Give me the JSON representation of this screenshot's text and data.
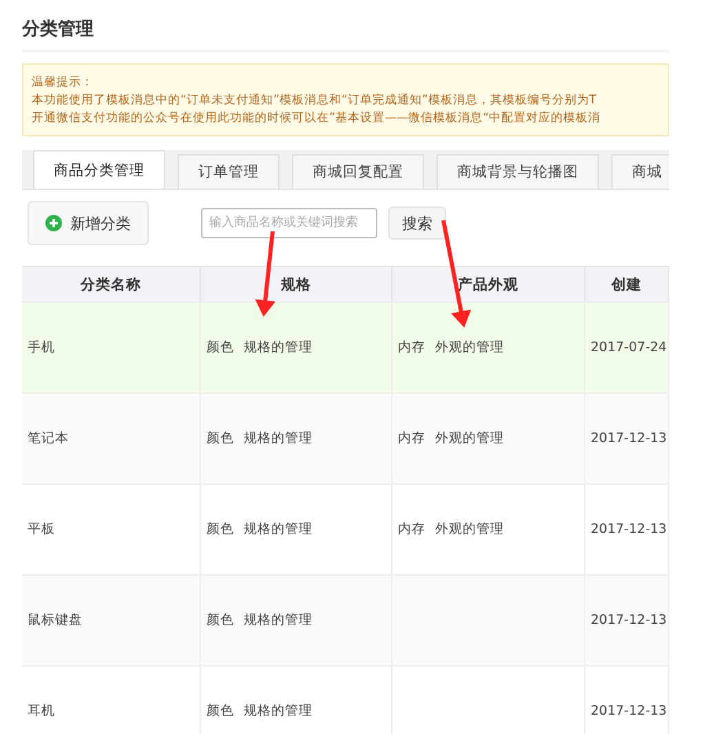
{
  "page_title": "分类管理",
  "notice": {
    "heading": "温馨提示：",
    "lines": [
      "本功能使用了模板消息中的“订单未支付通知”模板消息和“订单完成通知”模板消息，其模板编号分别为T",
      "开通微信支付功能的公众号在使用此功能的时候可以在”基本设置——微信模板消息“中配置对应的模板消"
    ]
  },
  "tabs": [
    {
      "label": "商品分类管理",
      "selected": true
    },
    {
      "label": "订单管理",
      "selected": false
    },
    {
      "label": "商城回复配置",
      "selected": false
    },
    {
      "label": "商城背景与轮播图",
      "selected": false
    },
    {
      "label": "商城",
      "selected": false
    }
  ],
  "toolbar": {
    "add_button": "新增分类",
    "search": {
      "placeholder": "输入商品名称或关键词搜索"
    },
    "search_button": "搜索"
  },
  "table": {
    "columns": [
      "分类名称",
      "规格",
      "产品外观",
      "创建"
    ],
    "rows": [
      {
        "name": "手机",
        "spec": [
          "颜色",
          "规格的管理"
        ],
        "appearance": [
          "内存",
          "外观的管理"
        ],
        "created": "2017-07-24",
        "selected": true
      },
      {
        "name": "笔记本",
        "spec": [
          "颜色",
          "规格的管理"
        ],
        "appearance": [
          "内存",
          "外观的管理"
        ],
        "created": "2017-12-13",
        "selected": false
      },
      {
        "name": "平板",
        "spec": [
          "颜色",
          "规格的管理"
        ],
        "appearance": [
          "内存",
          "外观的管理"
        ],
        "created": "2017-12-13",
        "selected": false
      },
      {
        "name": "鼠标键盘",
        "spec": [
          "颜色",
          "规格的管理"
        ],
        "appearance": [],
        "created": "2017-12-13",
        "selected": false
      },
      {
        "name": "耳机",
        "spec": [
          "颜色",
          "规格的管理"
        ],
        "appearance": [],
        "created": "2017-12-13",
        "selected": false
      }
    ]
  }
}
